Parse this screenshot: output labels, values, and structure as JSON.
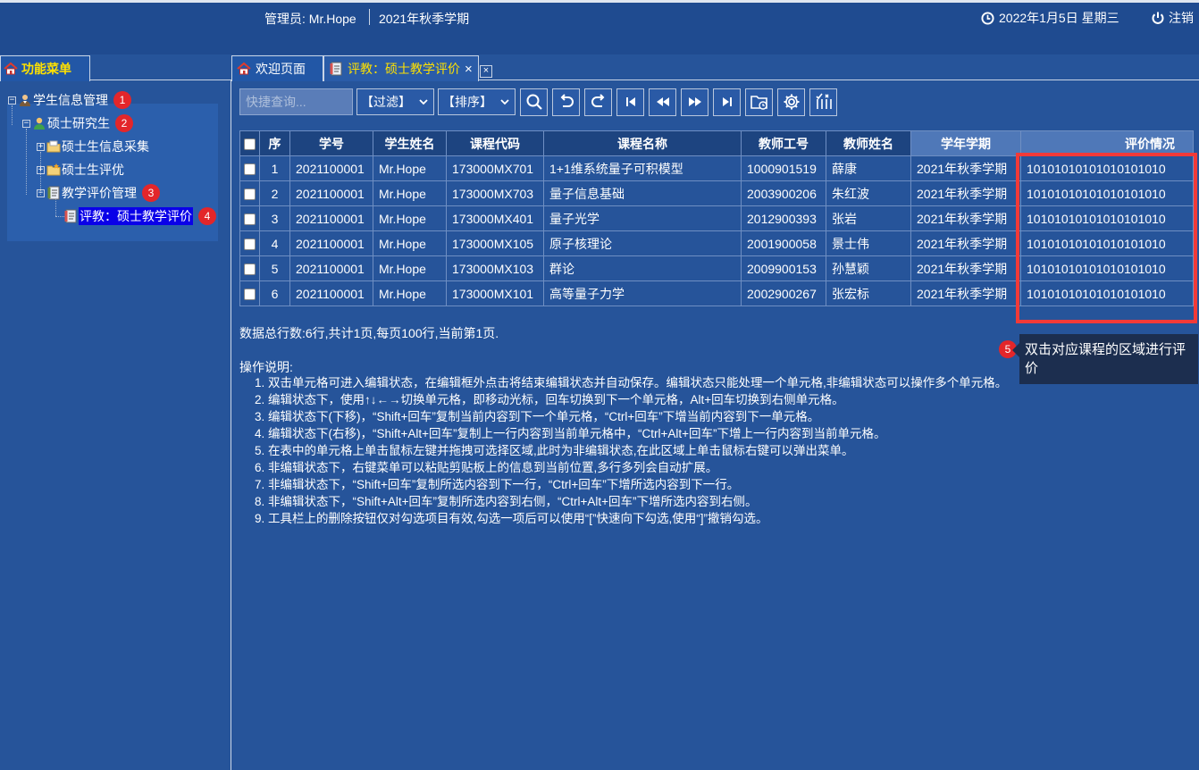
{
  "header": {
    "admin": "管理员: Mr.Hope",
    "term": "2021年秋季学期",
    "date": "2022年1月5日 星期三",
    "logout": "注销"
  },
  "left_tab": {
    "label": "功能菜单"
  },
  "tree": {
    "n1": "学生信息管理",
    "n2": "硕士研究生",
    "n3": "硕士生信息采集",
    "n4": "硕士生评优",
    "n5": "教学评价管理",
    "n6": "评教：硕士教学评价",
    "badges": [
      "1",
      "2",
      "3",
      "4"
    ]
  },
  "tabs": {
    "welcome": "欢迎页面",
    "active": "评教：硕士教学评价",
    "close_glyph": "×",
    "close_all_glyph": "×"
  },
  "toolbar": {
    "search_placeholder": "快捷查询...",
    "filter": "【过滤】",
    "sort": "【排序】"
  },
  "table": {
    "headers": [
      "序",
      "学号",
      "学生姓名",
      "课程代码",
      "课程名称",
      "教师工号",
      "教师姓名",
      "学年学期",
      "评价情况"
    ],
    "rows": [
      [
        "1",
        "2021100001",
        "Mr.Hope",
        "173000MX701",
        "1+1维系统量子可积模型",
        "1000901519",
        "薛康",
        "2021年秋季学期",
        "10101010101010101010"
      ],
      [
        "2",
        "2021100001",
        "Mr.Hope",
        "173000MX703",
        "量子信息基础",
        "2003900206",
        "朱红波",
        "2021年秋季学期",
        "10101010101010101010"
      ],
      [
        "3",
        "2021100001",
        "Mr.Hope",
        "173000MX401",
        "量子光学",
        "2012900393",
        "张岩",
        "2021年秋季学期",
        "10101010101010101010"
      ],
      [
        "4",
        "2021100001",
        "Mr.Hope",
        "173000MX105",
        "原子核理论",
        "2001900058",
        "景士伟",
        "2021年秋季学期",
        "10101010101010101010"
      ],
      [
        "5",
        "2021100001",
        "Mr.Hope",
        "173000MX103",
        "群论",
        "2009900153",
        "孙慧颖",
        "2021年秋季学期",
        "10101010101010101010"
      ],
      [
        "6",
        "2021100001",
        "Mr.Hope",
        "173000MX101",
        "高等量子力学",
        "2002900267",
        "张宏标",
        "2021年秋季学期",
        "10101010101010101010"
      ]
    ]
  },
  "summary": "数据总行数:6行,共计1页,每页100行,当前第1页.",
  "tooltip": {
    "badge": "5",
    "text": "双击对应课程的区域进行评价"
  },
  "instructions": {
    "title": "操作说明:",
    "items": [
      "1. 双击单元格可进入编辑状态，在编辑框外点击将结束编辑状态并自动保存。编辑状态只能处理一个单元格,非编辑状态可以操作多个单元格。",
      "2. 编辑状态下，使用↑↓←→切换单元格，即移动光标，回车切换到下一个单元格，Alt+回车切换到右侧单元格。",
      "3. 编辑状态下(下移)，“Shift+回车”复制当前内容到下一个单元格，“Ctrl+回车”下增当前内容到下一单元格。",
      "4. 编辑状态下(右移)，“Shift+Alt+回车”复制上一行内容到当前单元格中，“Ctrl+Alt+回车”下增上一行内容到当前单元格。",
      "5. 在表中的单元格上单击鼠标左键并拖拽可选择区域,此时为非编辑状态,在此区域上单击鼠标右键可以弹出菜单。",
      "6. 非编辑状态下，右键菜单可以粘贴剪贴板上的信息到当前位置,多行多列会自动扩展。",
      "7. 非编辑状态下，“Shift+回车”复制所选内容到下一行，“Ctrl+回车”下增所选内容到下一行。",
      "8. 非编辑状态下，“Shift+Alt+回车”复制所选内容到右侧，“Ctrl+Alt+回车”下增所选内容到右侧。",
      "9. 工具栏上的删除按钮仅对勾选项目有效,勾选一项后可以使用“[”快速向下勾选,使用“]”撤销勾选。"
    ]
  },
  "colors": {
    "background": "#26549a",
    "accent_yellow": "#ffe100",
    "highlight_red": "#f23a38",
    "badge_red": "#e3262a"
  }
}
